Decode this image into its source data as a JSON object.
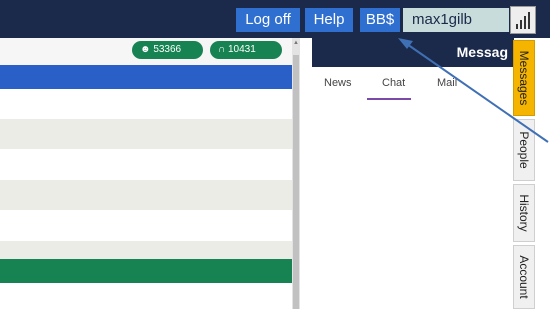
{
  "header": {
    "logoff_label": "Log off",
    "help_label": "Help",
    "bb_label": "BB$",
    "username": "max1gilb",
    "signal_icon": "signal-bars-icon"
  },
  "stats": {
    "members_count": "53366",
    "members_icon": "person-icon",
    "groups_count": "10431",
    "groups_icon": "people-group-icon"
  },
  "colors": {
    "topbar": "#1b2a4a",
    "button": "#2f6fd0",
    "stat_pill": "#178352",
    "selected_row": "#2a5fc8",
    "active_tab": "#f4b400",
    "chat_underline": "#7b4aa8"
  },
  "messages_panel": {
    "title": "Messag",
    "tabs": [
      "News",
      "Chat",
      "Mail"
    ],
    "active_tab": "Chat"
  },
  "side_tabs": [
    "Messages",
    "People",
    "History",
    "Account"
  ]
}
